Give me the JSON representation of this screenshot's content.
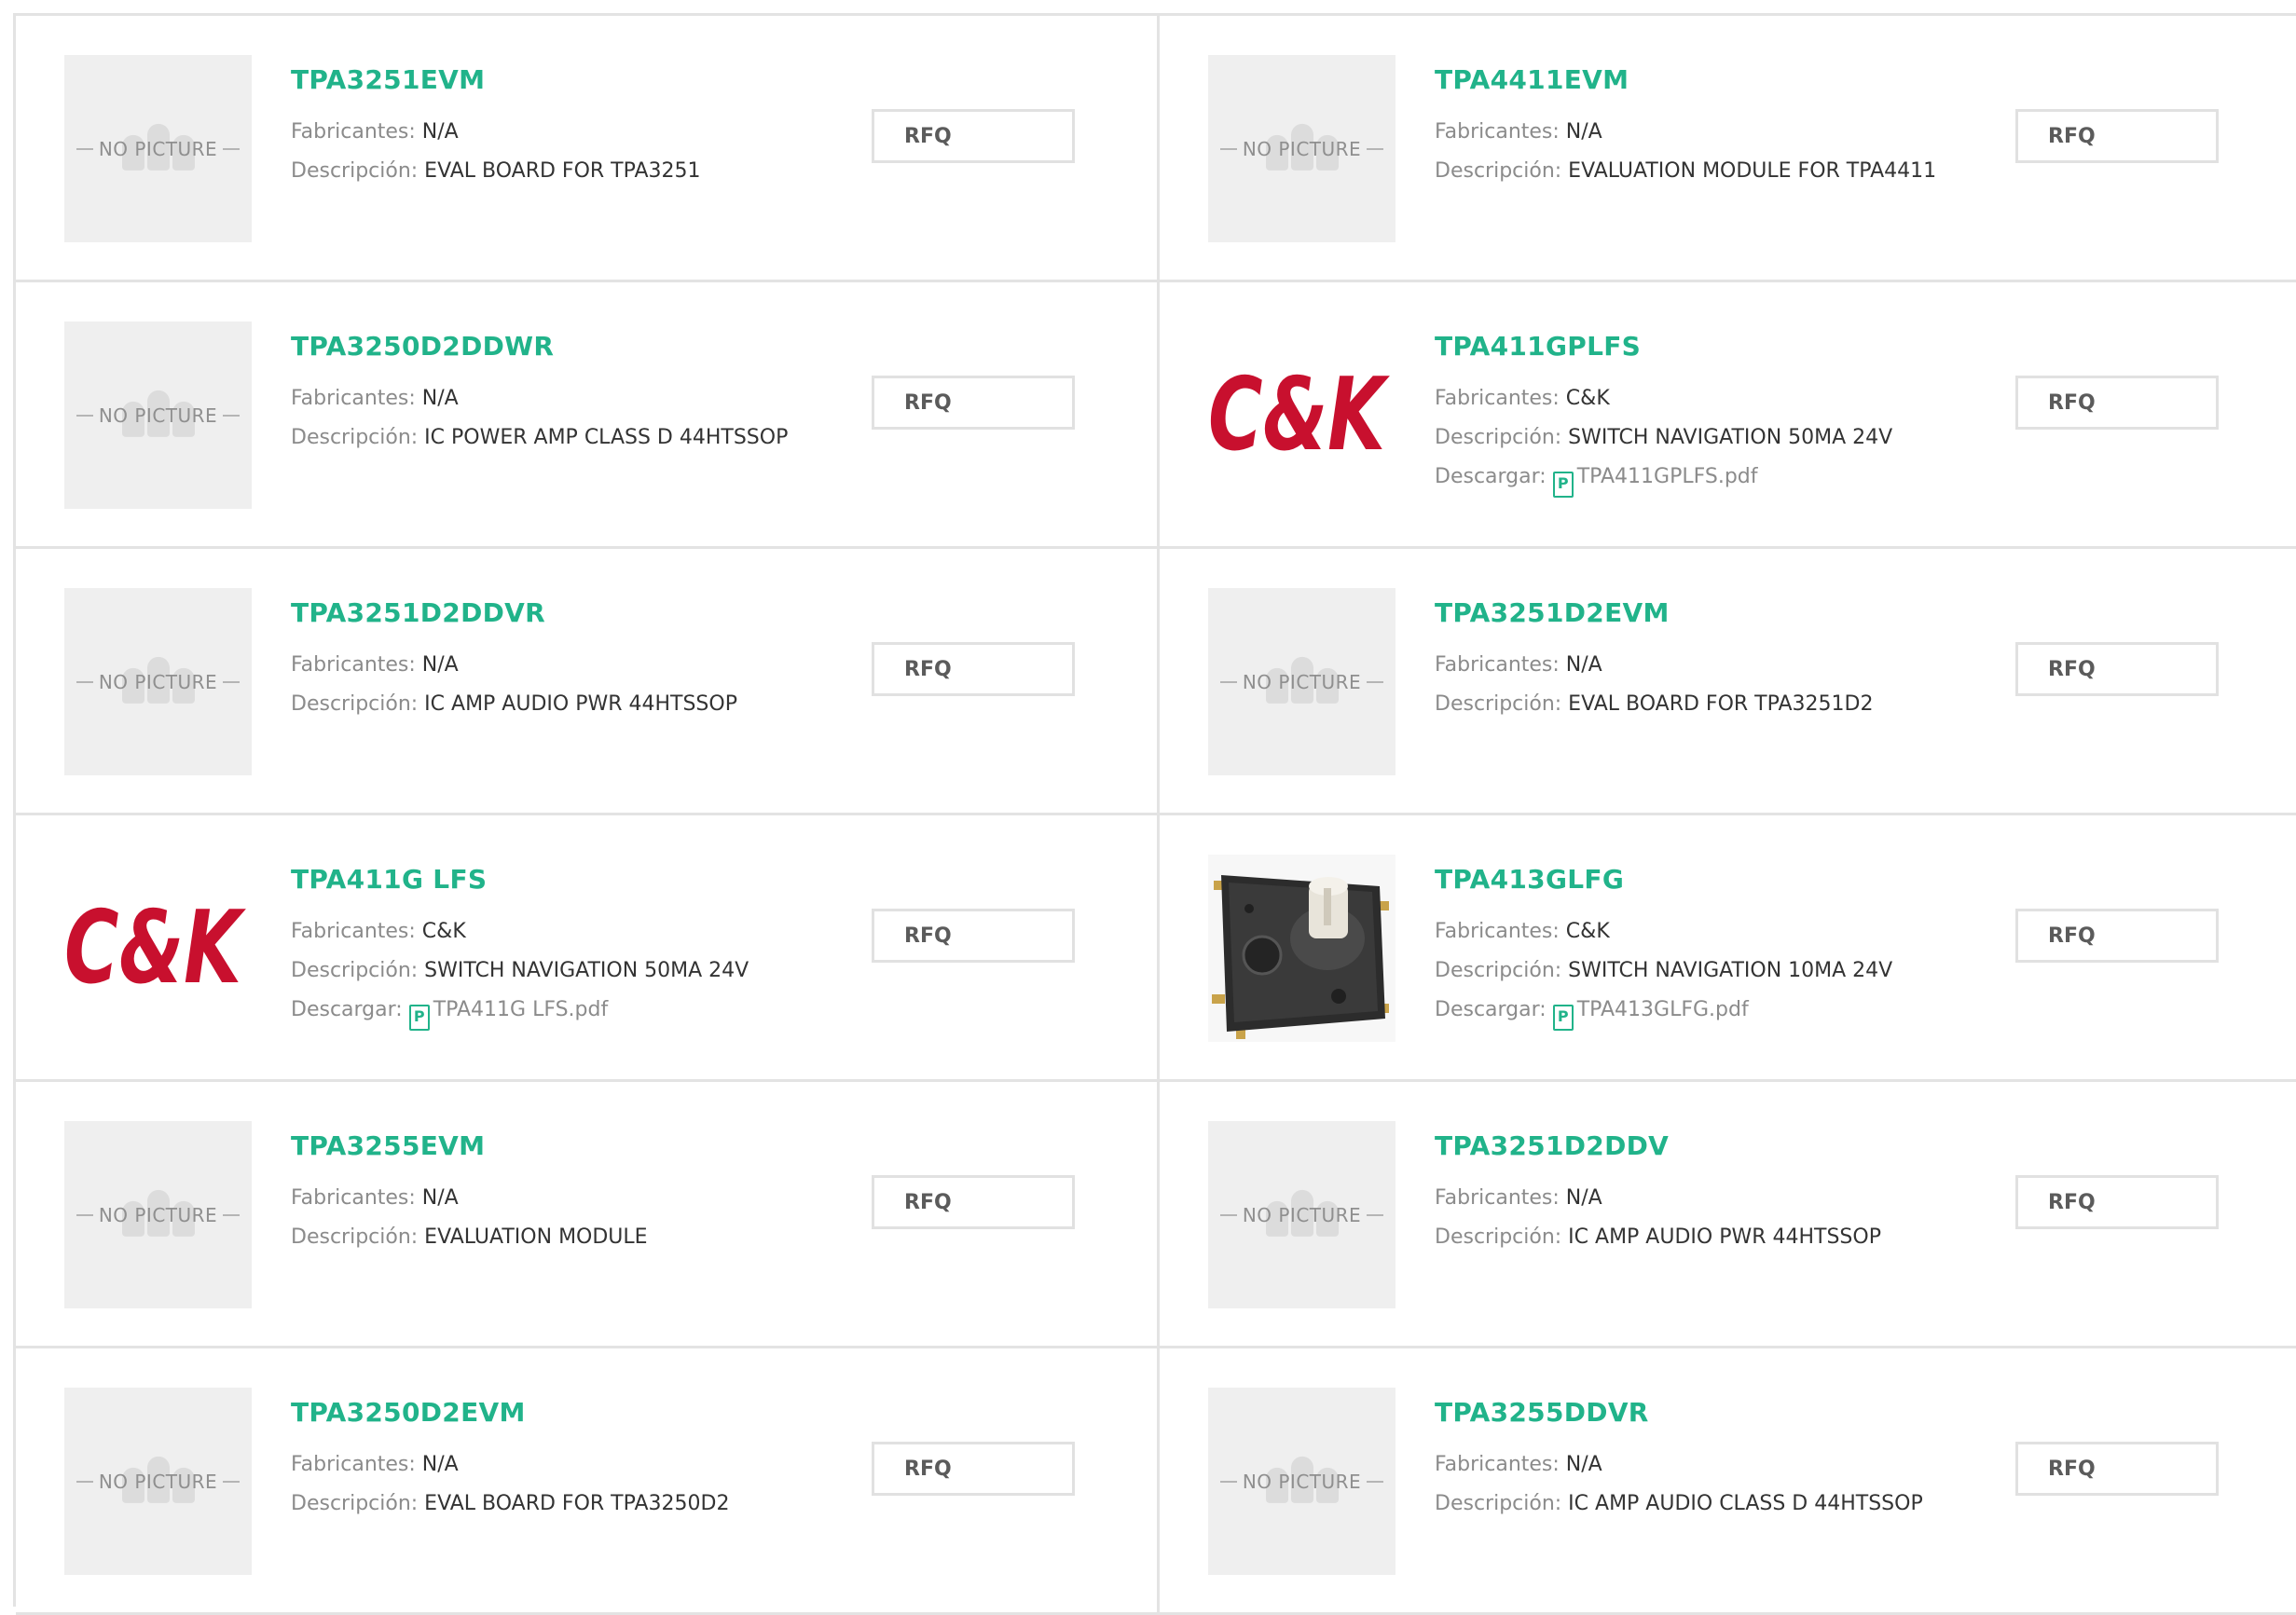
{
  "labels": {
    "manufacturer": "Fabricantes: ",
    "description": "Descripción: ",
    "download": "Descargar: ",
    "rfq": "RFQ",
    "no_picture": "NO PICTURE",
    "brand_logo": "C&K"
  },
  "colors": {
    "accent_green": "#21b38a",
    "ck_red": "#c8102e",
    "border": "#e3e3e3"
  },
  "products": [
    {
      "name": "TPA3251EVM",
      "manufacturer": "N/A",
      "description": "EVAL BOARD FOR TPA3251",
      "image": "no-picture"
    },
    {
      "name": "TPA4411EVM",
      "manufacturer": "N/A",
      "description": "EVALUATION MODULE FOR TPA4411",
      "image": "no-picture"
    },
    {
      "name": "TPA3250D2DDWR",
      "manufacturer": "N/A",
      "description": "IC POWER AMP CLASS D 44HTSSOP",
      "image": "no-picture"
    },
    {
      "name": "TPA411GPLFS",
      "manufacturer": "C&K",
      "description": "SWITCH NAVIGATION 50MA 24V",
      "download": "TPA411GPLFS.pdf",
      "image": "ck-logo"
    },
    {
      "name": "TPA3251D2DDVR",
      "manufacturer": "N/A",
      "description": "IC AMP AUDIO PWR 44HTSSOP",
      "image": "no-picture"
    },
    {
      "name": "TPA3251D2EVM",
      "manufacturer": "N/A",
      "description": "EVAL BOARD FOR TPA3251D2",
      "image": "no-picture"
    },
    {
      "name": "TPA411G LFS",
      "manufacturer": "C&K",
      "description": "SWITCH NAVIGATION 50MA 24V",
      "download": "TPA411G LFS.pdf",
      "image": "ck-logo"
    },
    {
      "name": "TPA413GLFG",
      "manufacturer": "C&K",
      "description": "SWITCH NAVIGATION 10MA 24V",
      "download": "TPA413GLFG.pdf",
      "image": "switch-photo"
    },
    {
      "name": "TPA3255EVM",
      "manufacturer": "N/A",
      "description": "EVALUATION MODULE",
      "image": "no-picture"
    },
    {
      "name": "TPA3251D2DDV",
      "manufacturer": "N/A",
      "description": "IC AMP AUDIO PWR 44HTSSOP",
      "image": "no-picture"
    },
    {
      "name": "TPA3250D2EVM",
      "manufacturer": "N/A",
      "description": "EVAL BOARD FOR TPA3250D2",
      "image": "no-picture"
    },
    {
      "name": "TPA3255DDVR",
      "manufacturer": "N/A",
      "description": "IC AMP AUDIO CLASS D 44HTSSOP",
      "image": "no-picture"
    }
  ]
}
